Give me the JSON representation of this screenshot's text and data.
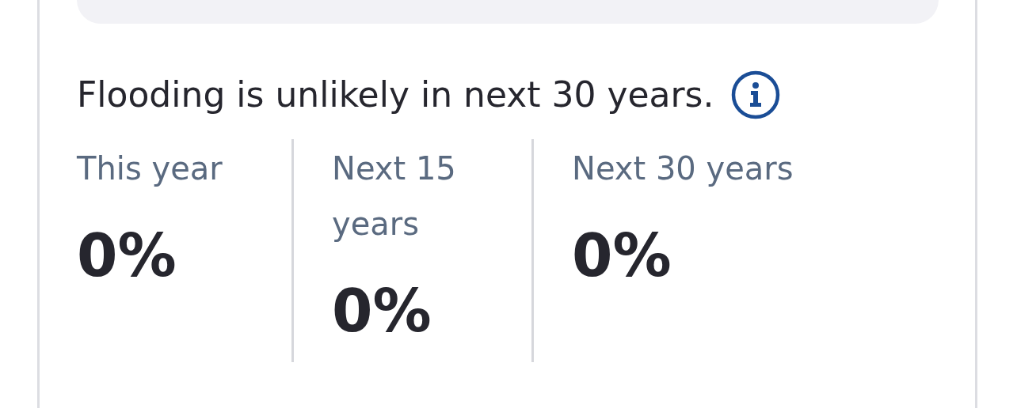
{
  "headline": "Flooding is unlikely in next 30 years.",
  "stats": [
    {
      "label": "This year",
      "value": "0%"
    },
    {
      "label": "Next 15 years",
      "value": "0%"
    },
    {
      "label": "Next 30 years",
      "value": "0%"
    }
  ]
}
